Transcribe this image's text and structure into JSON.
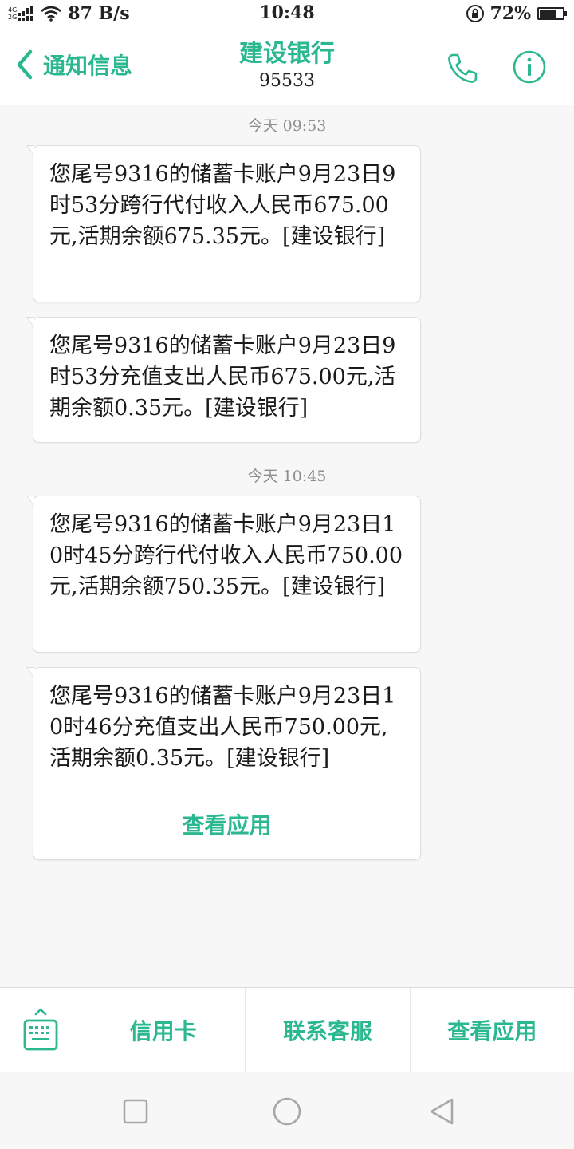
{
  "status_bar": {
    "network_top": "4G",
    "network_bottom": "2G",
    "net_speed": "87 B/s",
    "time": "10:48",
    "battery_percent": "72%",
    "battery_level": 0.72,
    "icons": [
      "signal-icon",
      "wifi-icon",
      "rotate-lock-icon",
      "battery-icon"
    ]
  },
  "header": {
    "back_label": "通知信息",
    "title": "建设银行",
    "number": "95533",
    "icons": [
      "back-chevron-icon",
      "phone-icon",
      "info-icon"
    ]
  },
  "conversation": {
    "groups": [
      {
        "timestamp": "今天 09:53",
        "messages": [
          "您尾号9316的储蓄卡账户9月23日9时53分跨行代付收入人民币675.00元,活期余额675.35元。[建设银行]",
          "您尾号9316的储蓄卡账户9月23日9时53分充值支出人民币675.00元,活期余额0.35元。[建设银行]"
        ]
      },
      {
        "timestamp": "今天 10:45",
        "messages": [
          "您尾号9316的储蓄卡账户9月23日10时45分跨行代付收入人民币750.00元,活期余额750.35元。[建设银行]",
          "您尾号9316的储蓄卡账户9月23日10时46分充值支出人民币750.00元,活期余额0.35元。[建设银行]"
        ],
        "last_message_action": "查看应用"
      }
    ]
  },
  "bottom_menu": {
    "keyboard_icon": "keyboard-icon",
    "items": [
      "信用卡",
      "联系客服",
      "查看应用"
    ]
  },
  "nav_bar": {
    "icons": [
      "recent-apps-icon",
      "home-icon",
      "back-icon"
    ]
  },
  "colors": {
    "accent": "#2bb890",
    "background": "#f7f7f7",
    "bubble": "#ffffff",
    "text": "#1a1a1a",
    "timestamp": "#8e8e8e"
  }
}
